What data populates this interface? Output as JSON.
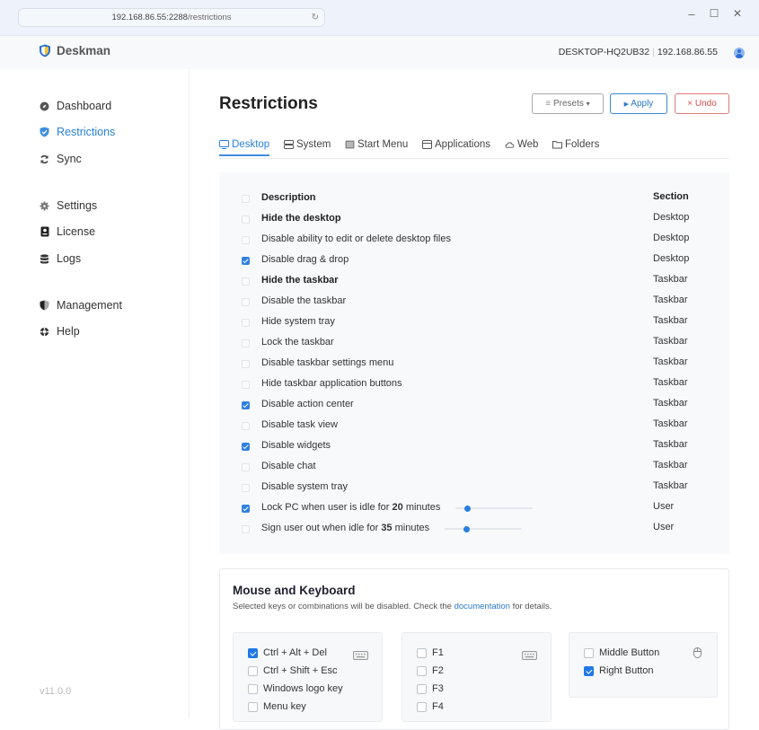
{
  "browser": {
    "url_host": "192.168.86.55:2288",
    "url_path": "/restrictions",
    "reload_icon": "↻",
    "minimize": "–",
    "maximize": "☐",
    "close": "✕"
  },
  "header": {
    "brand": "Deskman",
    "hostname": "DESKTOP-HQ2UB32",
    "separator": "|",
    "ip": "192.168.86.55"
  },
  "sidebar": {
    "items": [
      {
        "label": "Dashboard",
        "icon": "compass-icon"
      },
      {
        "label": "Restrictions",
        "icon": "shield-check-icon",
        "active": true
      },
      {
        "label": "Sync",
        "icon": "sync-icon"
      },
      {
        "label": "Settings",
        "icon": "gear-icon"
      },
      {
        "label": "License",
        "icon": "license-icon"
      },
      {
        "label": "Logs",
        "icon": "database-icon"
      },
      {
        "label": "Management",
        "icon": "shield-half-icon"
      },
      {
        "label": "Help",
        "icon": "lifebuoy-icon"
      }
    ],
    "version": "v11.0.0"
  },
  "page": {
    "title": "Restrictions",
    "buttons": {
      "presets": "Presets",
      "presets_icon": "≡",
      "presets_caret": "▾",
      "apply": "Apply",
      "apply_icon": "▶",
      "undo": "Undo",
      "undo_icon": "×"
    },
    "tabs": [
      {
        "label": "Desktop",
        "icon": "monitor-icon",
        "active": true
      },
      {
        "label": "System",
        "icon": "server-icon"
      },
      {
        "label": "Start Menu",
        "icon": "start-menu-icon"
      },
      {
        "label": "Applications",
        "icon": "window-icon"
      },
      {
        "label": "Web",
        "icon": "cloud-icon"
      },
      {
        "label": "Folders",
        "icon": "folder-icon"
      }
    ]
  },
  "table": {
    "header": {
      "description": "Description",
      "section": "Section"
    },
    "rows": [
      {
        "description": "Hide the desktop",
        "section": "Desktop",
        "checked": false,
        "bold": true
      },
      {
        "description": "Disable ability to edit or delete desktop files",
        "section": "Desktop",
        "checked": false
      },
      {
        "description": "Disable drag & drop",
        "section": "Desktop",
        "checked": true
      },
      {
        "description": "Hide the taskbar",
        "section": "Taskbar",
        "checked": false,
        "bold": true
      },
      {
        "description": "Disable the taskbar",
        "section": "Taskbar",
        "checked": false
      },
      {
        "description": "Hide system tray",
        "section": "Taskbar",
        "checked": false
      },
      {
        "description": "Lock the taskbar",
        "section": "Taskbar",
        "checked": false
      },
      {
        "description": "Disable taskbar settings menu",
        "section": "Taskbar",
        "checked": false
      },
      {
        "description": "Hide taskbar application buttons",
        "section": "Taskbar",
        "checked": false
      },
      {
        "description": "Disable action center",
        "section": "Taskbar",
        "checked": true
      },
      {
        "description": "Disable task view",
        "section": "Taskbar",
        "checked": false
      },
      {
        "description": "Disable widgets",
        "section": "Taskbar",
        "checked": true
      },
      {
        "description": "Disable chat",
        "section": "Taskbar",
        "checked": false
      },
      {
        "description": "Disable system tray",
        "section": "Taskbar",
        "checked": false
      }
    ],
    "idle_rows": [
      {
        "prefix": "Lock PC when user is idle for",
        "value": "20",
        "suffix": "minutes",
        "section": "User",
        "checked": true,
        "slider_fraction": 0.16
      },
      {
        "prefix": "Sign user out when idle for",
        "value": "35",
        "suffix": "minutes",
        "section": "User",
        "checked": false,
        "slider_fraction": 0.28
      }
    ]
  },
  "mouse_keyboard": {
    "title": "Mouse and Keyboard",
    "subtitle_before": "Selected keys or combinations will be disabled. Check the",
    "subtitle_link": "documentation",
    "subtitle_after": "for details.",
    "combos": [
      {
        "label": "Ctrl + Alt + Del",
        "checked": true
      },
      {
        "label": "Ctrl + Shift + Esc",
        "checked": false
      },
      {
        "label": "Windows logo key",
        "checked": false
      },
      {
        "label": "Menu key",
        "checked": false
      }
    ],
    "function_keys": [
      {
        "label": "F1",
        "checked": false
      },
      {
        "label": "F2",
        "checked": false
      },
      {
        "label": "F3",
        "checked": false
      },
      {
        "label": "F4",
        "checked": false
      }
    ],
    "mouse": [
      {
        "label": "Middle Button",
        "checked": false
      },
      {
        "label": "Right Button",
        "checked": true
      }
    ]
  }
}
